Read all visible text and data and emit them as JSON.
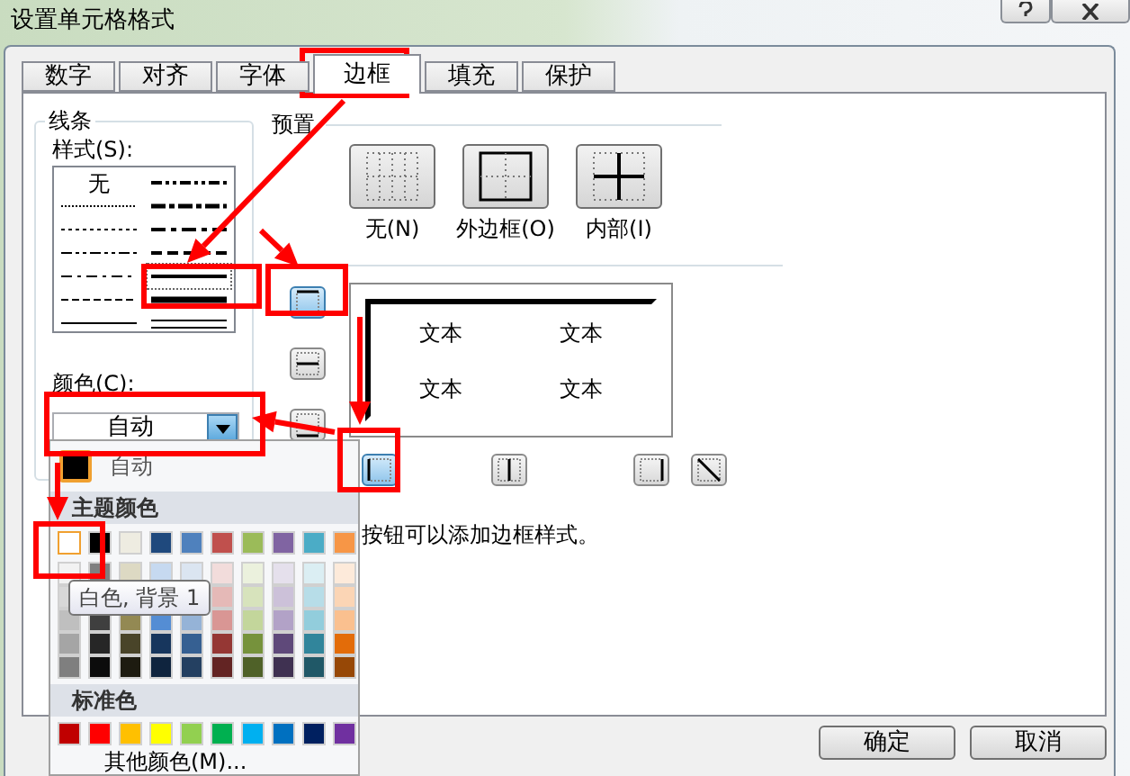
{
  "window": {
    "title": "设置单元格格式"
  },
  "tabs": [
    {
      "label": "数字",
      "selected": false
    },
    {
      "label": "对齐",
      "selected": false
    },
    {
      "label": "字体",
      "selected": false
    },
    {
      "label": "边框",
      "selected": true
    },
    {
      "label": "填充",
      "selected": false
    },
    {
      "label": "保护",
      "selected": false
    }
  ],
  "line": {
    "title": "线条",
    "style_label": "样式(S):",
    "styles": [
      {
        "kind": "none",
        "label": "无",
        "selected": false
      },
      {
        "kind": "medium-dash-dot-dot",
        "selected": false
      },
      {
        "kind": "hair",
        "selected": false
      },
      {
        "kind": "slant-dash-dot",
        "selected": false
      },
      {
        "kind": "dotted",
        "selected": false
      },
      {
        "kind": "medium-dash-dot",
        "selected": false
      },
      {
        "kind": "dash-dot-dot",
        "selected": false
      },
      {
        "kind": "medium-dashed",
        "selected": false
      },
      {
        "kind": "dash-dot",
        "selected": false
      },
      {
        "kind": "medium",
        "selected": true
      },
      {
        "kind": "dashed",
        "selected": false
      },
      {
        "kind": "thick",
        "selected": false
      },
      {
        "kind": "thin",
        "selected": false
      },
      {
        "kind": "double",
        "selected": false
      }
    ],
    "color_label": "颜色(C):",
    "color_value": "自动"
  },
  "presets": {
    "title": "预置",
    "items": [
      {
        "kind": "none",
        "label": "无(N)"
      },
      {
        "kind": "outline",
        "label": "外边框(O)"
      },
      {
        "kind": "inside",
        "label": "内部(I)"
      }
    ]
  },
  "border": {
    "side_buttons": [
      {
        "kind": "top",
        "selected": true
      },
      {
        "kind": "middle",
        "selected": false
      },
      {
        "kind": "bottom",
        "selected": false
      }
    ],
    "bottom_buttons": [
      {
        "kind": "left",
        "selected": true
      },
      {
        "kind": "center",
        "selected": false
      },
      {
        "kind": "right",
        "selected": false
      },
      {
        "kind": "diagonal",
        "selected": false
      }
    ],
    "preview_texts": [
      "文本",
      "文本",
      "文本",
      "文本"
    ]
  },
  "note_end": "按钮可以添加边框样式。",
  "color_popup": {
    "automatic": {
      "label": "自动",
      "selected": true
    },
    "theme_title": "主题颜色",
    "theme_colors": [
      [
        {
          "color": "#ffffff",
          "selected": true
        },
        {
          "color": "#000000",
          "selected": false
        },
        {
          "color": "#eeece1",
          "selected": false
        },
        {
          "color": "#1f497d",
          "selected": false
        },
        {
          "color": "#4f81bd",
          "selected": false
        },
        {
          "color": "#c0504d",
          "selected": false
        },
        {
          "color": "#9bbb59",
          "selected": false
        },
        {
          "color": "#8064a2",
          "selected": false
        },
        {
          "color": "#4bacc6",
          "selected": false
        },
        {
          "color": "#f79646",
          "selected": false
        }
      ],
      [
        {
          "color": "#f2f2f2",
          "selected": false
        },
        {
          "color": "#7f7f7f",
          "selected": false
        },
        {
          "color": "#ddd9c3",
          "selected": false
        },
        {
          "color": "#c6d9f0",
          "selected": false
        },
        {
          "color": "#dbe5f1",
          "selected": false
        },
        {
          "color": "#f2dcdb",
          "selected": false
        },
        {
          "color": "#ebf1dd",
          "selected": false
        },
        {
          "color": "#e5e0ec",
          "selected": false
        },
        {
          "color": "#dbeef3",
          "selected": false
        },
        {
          "color": "#fdeada",
          "selected": false
        }
      ],
      [
        {
          "color": "#d8d8d8",
          "selected": false
        },
        {
          "color": "#e5b9b7",
          "selected": false
        },
        {
          "color": "#d7e3bc",
          "selected": false
        },
        {
          "color": "#ccc1d9",
          "selected": false
        },
        {
          "color": "#b7dde8",
          "selected": false
        },
        {
          "color": "#fbd5b5",
          "selected": false
        }
      ],
      [
        {
          "color": "#bfbfbf",
          "selected": false
        },
        {
          "color": "#3f3f3f",
          "selected": false
        },
        {
          "color": "#938953",
          "selected": false
        },
        {
          "color": "#548dd4",
          "selected": false
        },
        {
          "color": "#95b3d7",
          "selected": false
        },
        {
          "color": "#d99694",
          "selected": false
        },
        {
          "color": "#c3d69b",
          "selected": false
        },
        {
          "color": "#b2a2c7",
          "selected": false
        },
        {
          "color": "#92cddc",
          "selected": false
        },
        {
          "color": "#fac08f",
          "selected": false
        }
      ],
      [
        {
          "color": "#a5a5a5",
          "selected": false
        },
        {
          "color": "#262626",
          "selected": false
        },
        {
          "color": "#494429",
          "selected": false
        },
        {
          "color": "#17365d",
          "selected": false
        },
        {
          "color": "#366092",
          "selected": false
        },
        {
          "color": "#953734",
          "selected": false
        },
        {
          "color": "#76923c",
          "selected": false
        },
        {
          "color": "#5f497a",
          "selected": false
        },
        {
          "color": "#31859b",
          "selected": false
        },
        {
          "color": "#e36c09",
          "selected": false
        }
      ],
      [
        {
          "color": "#7f7f7f",
          "selected": false
        },
        {
          "color": "#0c0c0c",
          "selected": false
        },
        {
          "color": "#1d1b10",
          "selected": false
        },
        {
          "color": "#0f243e",
          "selected": false
        },
        {
          "color": "#244061",
          "selected": false
        },
        {
          "color": "#632423",
          "selected": false
        },
        {
          "color": "#4f6128",
          "selected": false
        },
        {
          "color": "#3f3151",
          "selected": false
        },
        {
          "color": "#205867",
          "selected": false
        },
        {
          "color": "#974806",
          "selected": false
        }
      ]
    ],
    "standard_title": "标准色",
    "standard_colors": [
      {
        "color": "#c00000",
        "selected": false
      },
      {
        "color": "#ff0000",
        "selected": false
      },
      {
        "color": "#ffc000",
        "selected": false
      },
      {
        "color": "#ffff00",
        "selected": false
      },
      {
        "color": "#92d050",
        "selected": false
      },
      {
        "color": "#00b050",
        "selected": false
      },
      {
        "color": "#00b0f0",
        "selected": false
      },
      {
        "color": "#0070c0",
        "selected": false
      },
      {
        "color": "#002060",
        "selected": false
      },
      {
        "color": "#7030a0",
        "selected": false
      }
    ],
    "more": "其他颜色(M)...",
    "tooltip": "白色, 背景 1"
  },
  "buttons": [
    {
      "label": "确定"
    },
    {
      "label": "取消"
    }
  ]
}
